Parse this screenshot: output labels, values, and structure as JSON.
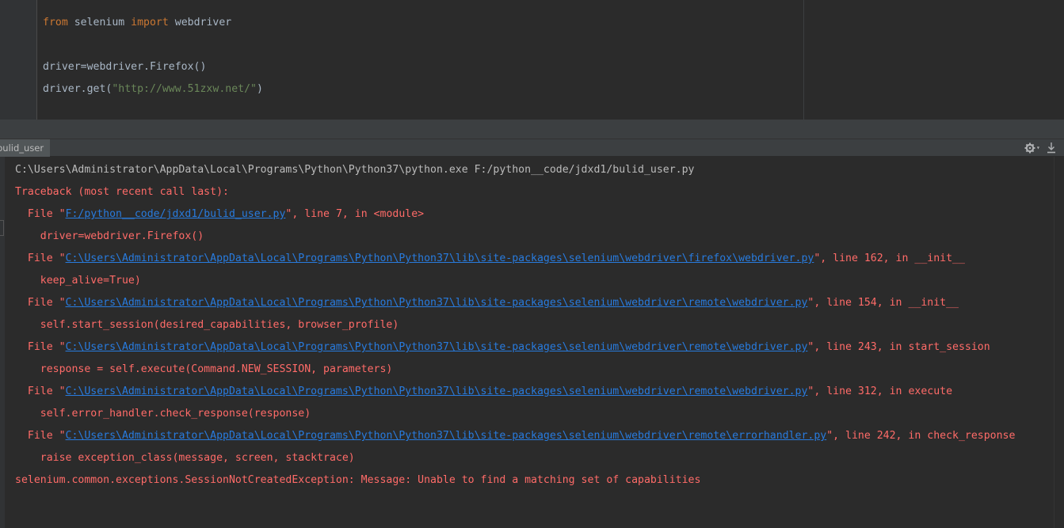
{
  "editor": {
    "lines": {
      "l1": {
        "kw1": "from",
        "mid": " selenium ",
        "kw2": "import",
        "tail": " webdriver"
      },
      "l3": "driver=webdriver.Firefox()",
      "l4": {
        "pre": "driver.get(",
        "str": "\"http://www.51zxw.net/\"",
        "post": ")"
      }
    }
  },
  "run_panel": {
    "tab_label": "bulid_user",
    "icons": {
      "settings": "gear-icon",
      "settings_caret": "▾",
      "pin": "pin-icon"
    }
  },
  "console": {
    "command": "C:\\Users\\Administrator\\AppData\\Local\\Programs\\Python\\Python37\\python.exe F:/python__code/jdxd1/bulid_user.py",
    "traceback_header": "Traceback (most recent call last):",
    "frames": [
      {
        "prefix": "  File \"",
        "path": "F:/python__code/jdxd1/bulid_user.py",
        "suffix": "\", line 7, in <module>",
        "code": "    driver=webdriver.Firefox()"
      },
      {
        "prefix": "  File \"",
        "path": "C:\\Users\\Administrator\\AppData\\Local\\Programs\\Python\\Python37\\lib\\site-packages\\selenium\\webdriver\\firefox\\webdriver.py",
        "suffix": "\", line 162, in __init__",
        "code": "    keep_alive=True)"
      },
      {
        "prefix": "  File \"",
        "path": "C:\\Users\\Administrator\\AppData\\Local\\Programs\\Python\\Python37\\lib\\site-packages\\selenium\\webdriver\\remote\\webdriver.py",
        "suffix": "\", line 154, in __init__",
        "code": "    self.start_session(desired_capabilities, browser_profile)"
      },
      {
        "prefix": "  File \"",
        "path": "C:\\Users\\Administrator\\AppData\\Local\\Programs\\Python\\Python37\\lib\\site-packages\\selenium\\webdriver\\remote\\webdriver.py",
        "suffix": "\", line 243, in start_session",
        "code": "    response = self.execute(Command.NEW_SESSION, parameters)"
      },
      {
        "prefix": "  File \"",
        "path": "C:\\Users\\Administrator\\AppData\\Local\\Programs\\Python\\Python37\\lib\\site-packages\\selenium\\webdriver\\remote\\webdriver.py",
        "suffix": "\", line 312, in execute",
        "code": "    self.error_handler.check_response(response)"
      },
      {
        "prefix": "  File \"",
        "path": "C:\\Users\\Administrator\\AppData\\Local\\Programs\\Python\\Python37\\lib\\site-packages\\selenium\\webdriver\\remote\\errorhandler.py",
        "suffix": "\", line 242, in check_response",
        "code": "    raise exception_class(message, screen, stacktrace)"
      }
    ],
    "exception": "selenium.common.exceptions.SessionNotCreatedException: Message: Unable to find a matching set of capabilities"
  },
  "colors": {
    "background": "#2b2b2b",
    "keyword": "#cc7832",
    "string": "#6a8759",
    "text": "#a9b7c6",
    "error": "#ff6b68",
    "link": "#287bde"
  }
}
